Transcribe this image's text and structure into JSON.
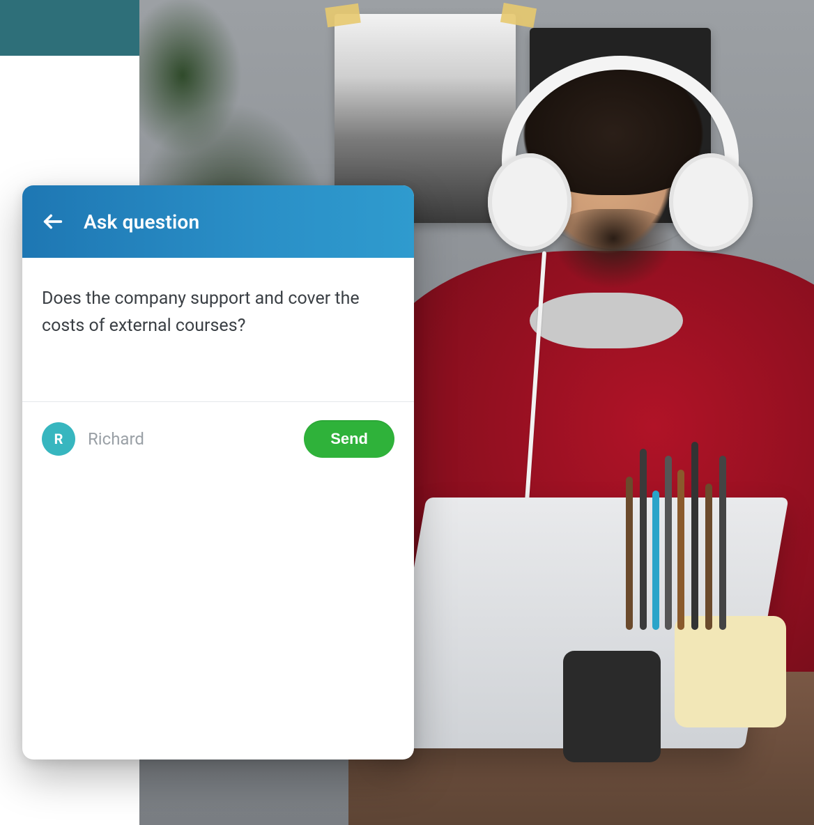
{
  "header": {
    "title": "Ask question"
  },
  "question": {
    "text": "Does the company support and cover the costs of external courses?"
  },
  "sender": {
    "initial": "R",
    "name": "Richard"
  },
  "actions": {
    "send_label": "Send"
  },
  "colors": {
    "header_start": "#1e77b3",
    "header_end": "#2f9bce",
    "send": "#2fb23a",
    "avatar": "#37b6bf"
  }
}
